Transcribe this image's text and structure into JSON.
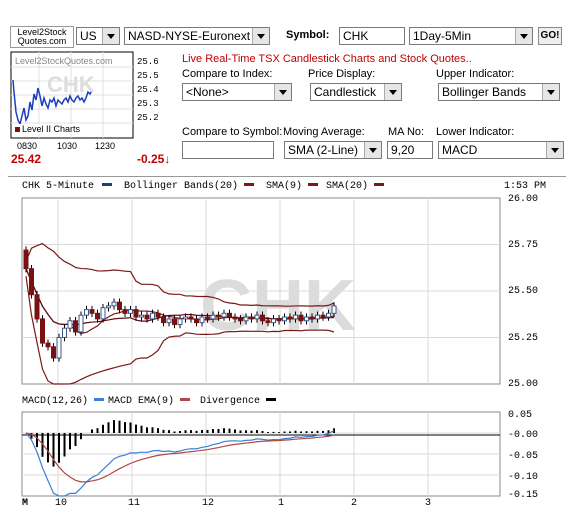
{
  "header": {
    "logo_line1": "Level2Stock",
    "logo_line2": "Quotes.com",
    "country": "US",
    "exchange": "NASD-NYSE-Euronext",
    "symbol_label": "Symbol:",
    "symbol_value": "CHK",
    "period": "1Day-5Min",
    "go_label": "GO!"
  },
  "thumb": {
    "watermark_site": "Level2StockQuotes.com",
    "watermark_sym": "CHK",
    "ylabels": [
      "25.6",
      "25.5",
      "25.4",
      "25.3",
      "25.2"
    ],
    "xlabels": [
      "0830",
      "1030",
      "1230"
    ],
    "legend": "Level II Charts",
    "price": "25.42",
    "change": "-0.25"
  },
  "controls": {
    "title": "Live Real-Time TSX Candlestick Charts and Stock Quotes..",
    "compare_index_label": "Compare to Index:",
    "compare_index_value": "<None>",
    "price_display_label": "Price Display:",
    "price_display_value": "Candlestick",
    "upper_indicator_label": "Upper Indicator:",
    "upper_indicator_value": "Bollinger Bands",
    "compare_symbol_label": "Compare to Symbol:",
    "compare_symbol_value": "",
    "moving_average_label": "Moving Average:",
    "moving_average_value": "SMA (2-Line)",
    "ma_no_label": "MA No:",
    "ma_no_value": "9,20",
    "lower_indicator_label": "Lower Indicator:",
    "lower_indicator_value": "MACD"
  },
  "chart": {
    "legend_main": "CHK 5-Minute",
    "legend_bb": "Bollinger Bands(20)",
    "legend_sma9": "SMA(9)",
    "legend_sma20": "SMA(20)",
    "time": "1:53 PM",
    "watermark": "CHK",
    "price_ticks": [
      "26.00",
      "25.75",
      "25.50",
      "25.25",
      "25.00"
    ],
    "macd_legend": "MACD(12,26)",
    "macd_ema_legend": "MACD EMA(9)",
    "divergence_legend": "Divergence",
    "macd_ticks": [
      "0.05",
      "-0.00",
      "-0.05",
      "-0.10",
      "-0.15"
    ],
    "x_labels": [
      "M",
      "10",
      "11",
      "12",
      "1",
      "2",
      "3"
    ],
    "colors": {
      "candle_up": "#3a5a8c",
      "candle_down": "#7a1010",
      "sma9": "#7a1818",
      "bb": "#7a1818",
      "macd": "#3a7fd8",
      "macd_ema": "#b04848",
      "divergence": "#000000"
    }
  },
  "chart_data": {
    "type": "candlestick",
    "ylim": [
      25.0,
      26.0
    ],
    "x": [
      "10",
      "11",
      "12",
      "1",
      "2",
      "3"
    ],
    "series": [
      {
        "name": "Bollinger Bands(20)",
        "type": "band"
      },
      {
        "name": "SMA(9)",
        "type": "line"
      },
      {
        "name": "SMA(20)",
        "type": "line"
      }
    ],
    "closes": [
      25.62,
      25.48,
      25.35,
      25.22,
      25.2,
      25.14,
      25.25,
      25.3,
      25.34,
      25.28,
      25.37,
      25.4,
      25.38,
      25.35,
      25.41,
      25.42,
      25.44,
      25.4,
      25.38,
      25.4,
      25.36,
      25.37,
      25.35,
      25.38,
      25.36,
      25.33,
      25.35,
      25.32,
      25.35,
      25.36,
      25.35,
      25.33,
      25.36,
      25.35,
      25.37,
      25.36,
      25.38,
      25.36,
      25.35,
      25.34,
      25.36,
      25.35,
      25.37,
      25.34,
      25.33,
      25.35,
      25.34,
      25.36,
      25.35,
      25.37,
      25.34,
      25.36,
      25.35,
      25.37,
      25.36,
      25.38,
      25.42
    ],
    "lower": {
      "type": "macd",
      "ylim": [
        -0.15,
        0.05
      ],
      "series": [
        {
          "name": "MACD(12,26)"
        },
        {
          "name": "MACD EMA(9)"
        },
        {
          "name": "Divergence"
        }
      ]
    }
  }
}
